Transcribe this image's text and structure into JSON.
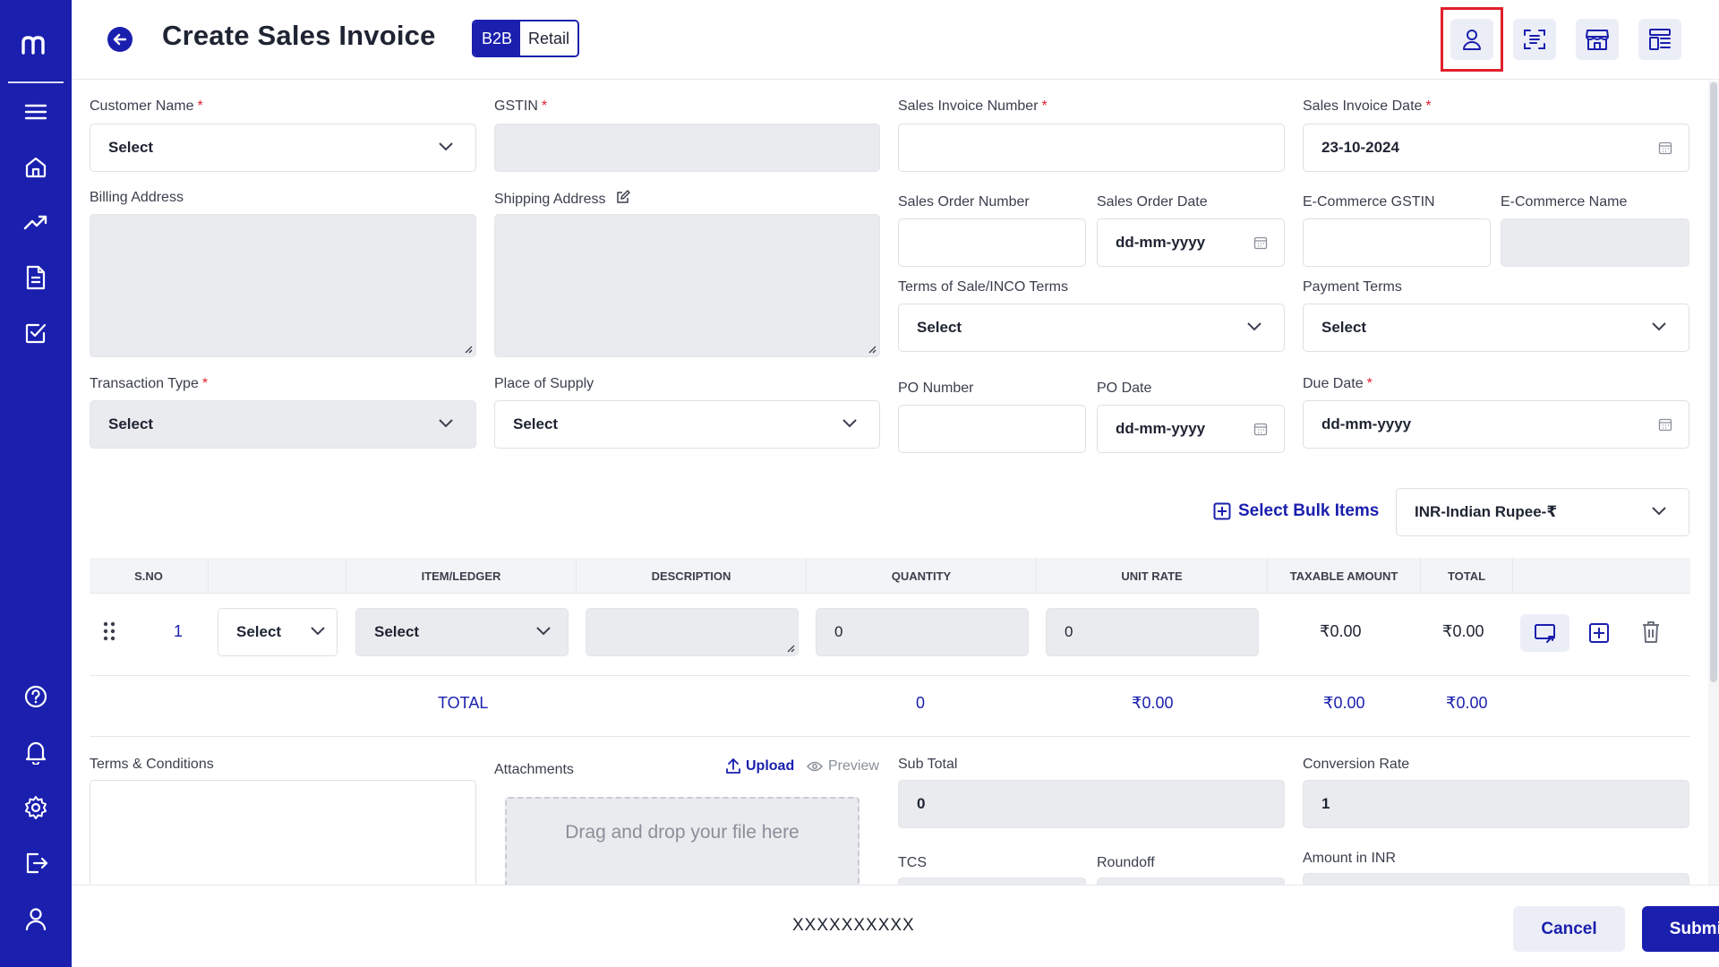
{
  "header": {
    "title": "Create Sales Invoice",
    "toggle": {
      "active": "B2B",
      "inactive": "Retail"
    },
    "buttons": [
      "customer-icon",
      "scan-icon",
      "store-icon",
      "layout-icon"
    ]
  },
  "form": {
    "customer_name": {
      "label": "Customer Name",
      "value": "Select"
    },
    "gstin": {
      "label": "GSTIN",
      "value": ""
    },
    "sales_invoice_number": {
      "label": "Sales Invoice Number",
      "value": ""
    },
    "sales_invoice_date": {
      "label": "Sales Invoice Date",
      "value": "23-10-2024"
    },
    "billing_address": {
      "label": "Billing Address"
    },
    "shipping_address": {
      "label": "Shipping Address"
    },
    "sales_order_number": {
      "label": "Sales Order Number"
    },
    "sales_order_date": {
      "label": "Sales Order Date",
      "value": "dd-mm-yyyy"
    },
    "ecommerce_gstin": {
      "label": "E-Commerce GSTIN"
    },
    "ecommerce_name": {
      "label": "E-Commerce Name"
    },
    "terms_of_sale": {
      "label": "Terms of Sale/INCO Terms",
      "value": "Select"
    },
    "payment_terms": {
      "label": "Payment Terms",
      "value": "Select"
    },
    "transaction_type": {
      "label": "Transaction Type",
      "value": "Select"
    },
    "place_of_supply": {
      "label": "Place of Supply",
      "value": "Select"
    },
    "po_number": {
      "label": "PO Number"
    },
    "po_date": {
      "label": "PO Date",
      "value": "dd-mm-yyyy"
    },
    "due_date": {
      "label": "Due Date",
      "value": "dd-mm-yyyy"
    }
  },
  "items": {
    "bulk_label": "Select Bulk Items",
    "currency": "INR-Indian Rupee-₹",
    "columns": [
      "S.NO",
      "ITEM/LEDGER",
      "DESCRIPTION",
      "QUANTITY",
      "UNIT RATE",
      "TAXABLE AMOUNT",
      "TOTAL"
    ],
    "rows": [
      {
        "sno": "1",
        "type": "Select",
        "item": "Select",
        "quantity": "0",
        "unit_rate": "0",
        "taxable": "₹0.00",
        "total": "₹0.00"
      }
    ],
    "totals": {
      "label": "TOTAL",
      "quantity": "0",
      "unit_rate": "₹0.00",
      "taxable": "₹0.00",
      "total": "₹0.00"
    }
  },
  "bottom": {
    "terms_label": "Terms & Conditions",
    "attachments_label": "Attachments",
    "upload_label": "Upload",
    "preview_label": "Preview",
    "dropzone_text": "Drag and drop your file here",
    "sub_total": {
      "label": "Sub Total",
      "value": "0"
    },
    "conversion_rate": {
      "label": "Conversion Rate",
      "value": "1"
    },
    "tcs_label": "TCS",
    "roundoff_label": "Roundoff",
    "amount_inr_label": "Amount in INR"
  },
  "footer": {
    "code": "XXXXXXXXXX",
    "cancel": "Cancel",
    "submit": "Submit"
  },
  "colors": {
    "brand": "#1a1fae",
    "highlight": "#e0202c",
    "field_grey": "#e9ebee"
  }
}
